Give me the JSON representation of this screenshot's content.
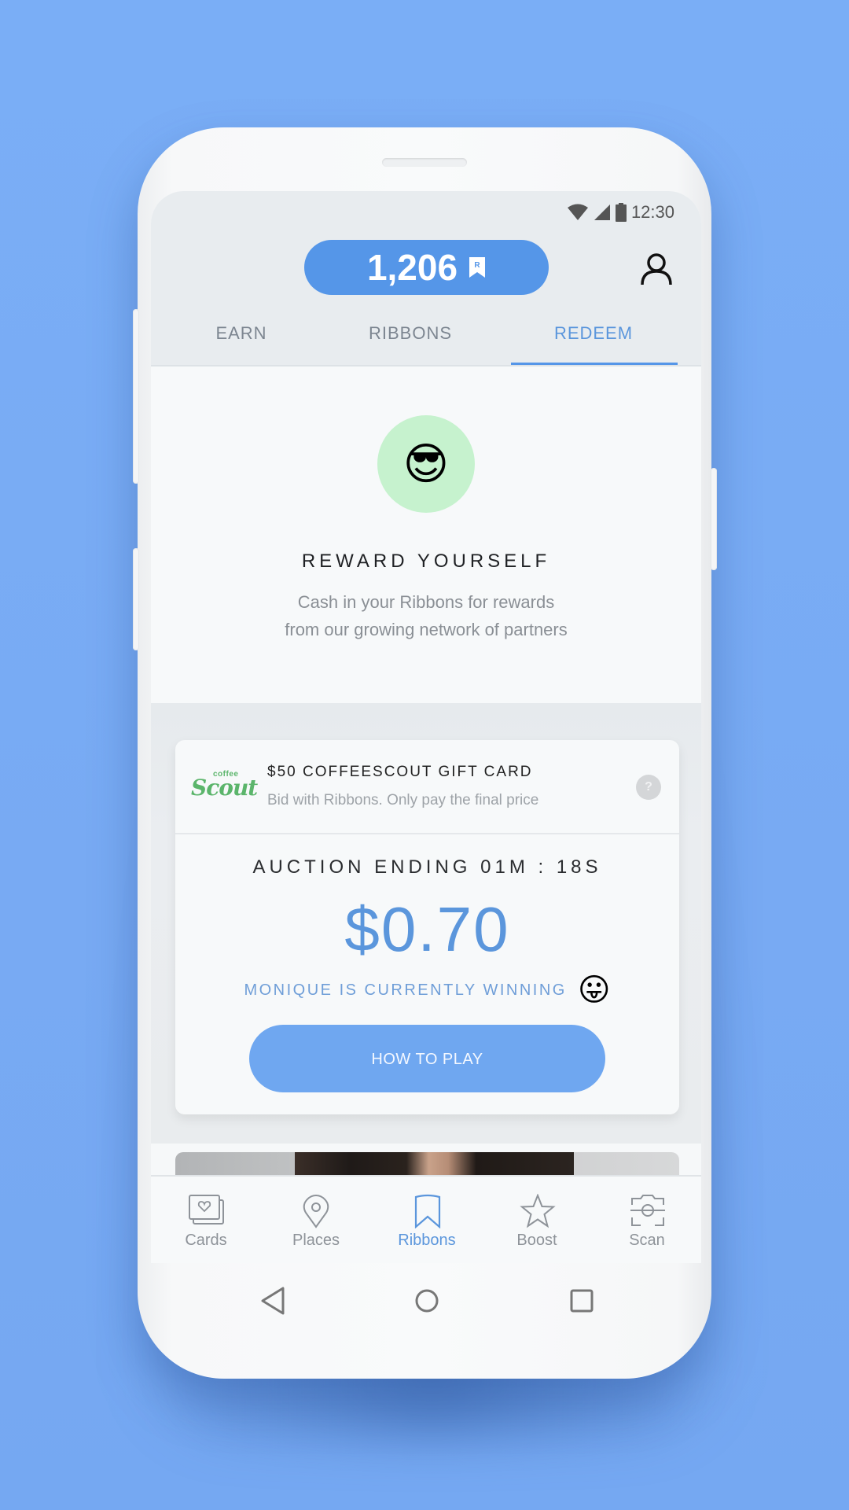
{
  "status_bar": {
    "time": "12:30",
    "icons": [
      "wifi-icon",
      "signal-icon",
      "battery-icon"
    ]
  },
  "header": {
    "points": "1,206",
    "points_icon": "ribbon-r-icon",
    "profile_icon": "person-icon"
  },
  "tabs": [
    {
      "label": "EARN",
      "active": false
    },
    {
      "label": "RIBBONS",
      "active": false
    },
    {
      "label": "REDEEM",
      "active": true
    }
  ],
  "hero": {
    "emoji": "😎",
    "title": "REWARD YOURSELF",
    "subtitle_line1": "Cash in your Ribbons for rewards",
    "subtitle_line2": "from our growing network of partners"
  },
  "auction_card": {
    "logo_small": "coffee",
    "logo_big": "Scout",
    "title": "$50 COFFEESCOUT GIFT CARD",
    "subtitle": "Bid with Ribbons. Only pay the final price",
    "help_label": "?",
    "ending": "AUCTION ENDING 01M : 18S",
    "price": "$0.70",
    "winner": "MONIQUE IS CURRENTLY WINNING",
    "winner_emoji": "😛",
    "button": "HOW TO PLAY"
  },
  "bottom_nav": [
    {
      "label": "Cards",
      "icon": "cards-heart-icon",
      "active": false
    },
    {
      "label": "Places",
      "icon": "map-pin-icon",
      "active": false
    },
    {
      "label": "Ribbons",
      "icon": "ribbon-bookmark-icon",
      "active": true
    },
    {
      "label": "Boost",
      "icon": "star-icon",
      "active": false
    },
    {
      "label": "Scan",
      "icon": "scan-camera-icon",
      "active": false
    }
  ],
  "system_nav": [
    "back",
    "home",
    "recents"
  ],
  "colors": {
    "accent": "#5596e8",
    "background": "#78aaf3",
    "hero_circle": "#c6f2ce",
    "logo_green": "#5bb56b"
  }
}
